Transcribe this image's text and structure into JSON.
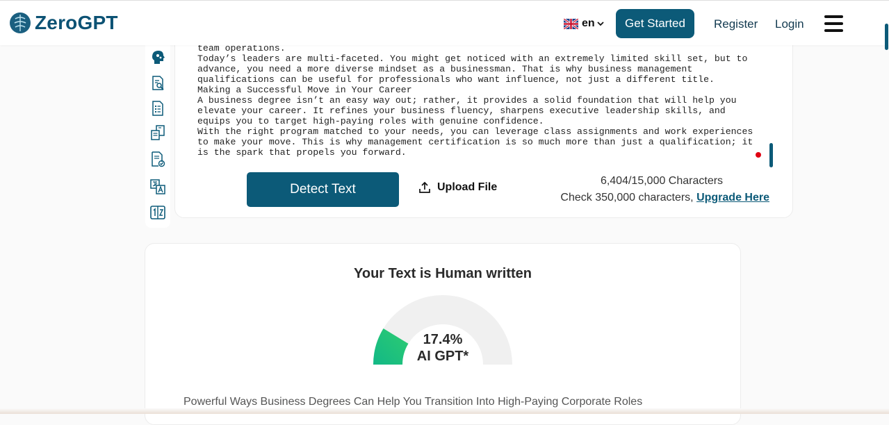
{
  "header": {
    "logo_text": "ZeroGPT",
    "language": "en",
    "get_started_label": "Get Started",
    "register_label": "Register",
    "login_label": "Login"
  },
  "colors": {
    "brand": "#0c5a78",
    "alert_dot": "#e00012",
    "gauge_fill_start": "#12b886",
    "gauge_fill_end": "#2ecc71",
    "gauge_track": "#f0f0f0"
  },
  "sidebar": {
    "icons": [
      "ai-detector-icon",
      "document-search-icon",
      "document-list-icon",
      "paraphrase-icon",
      "grammar-check-icon",
      "translate-icon",
      "word-counter-icon"
    ]
  },
  "editor": {
    "lines": [
      "team operations.",
      "Today’s leaders are multi-faceted. You might get noticed with an extremely limited skill set, but to",
      "advance, you need a more diverse mindset as a businessman. That is why business management",
      "qualifications can be useful for professionals who want influence, not just a different title.",
      "Making a Successful Move in Your Career",
      "A business degree isn’t an easy way out; rather, it provides a solid foundation that will help you",
      "elevate your career. It refines your business fluency, sharpens executive leadership skills, and",
      "equips you to target high-paying roles with genuine confidence.",
      "With the right program matched to your needs, you can leverage class assignments and work experiences",
      "to make your move. This is why management certification is so much more than just a qualification; it",
      "is the spark that propels you forward."
    ],
    "detect_label": "Detect Text",
    "upload_label": "Upload File",
    "char_count": "6,404/15,000 Characters",
    "upgrade_prefix": "Check 350,000 characters, ",
    "upgrade_link": "Upgrade Here"
  },
  "result": {
    "title": "Your Text is Human written",
    "ai_percent": 17.4,
    "ai_percent_text": "17.4%",
    "ai_label": "AI GPT*",
    "excerpt": "Powerful Ways Business Degrees Can Help You Transition Into High-Paying Corporate Roles"
  }
}
